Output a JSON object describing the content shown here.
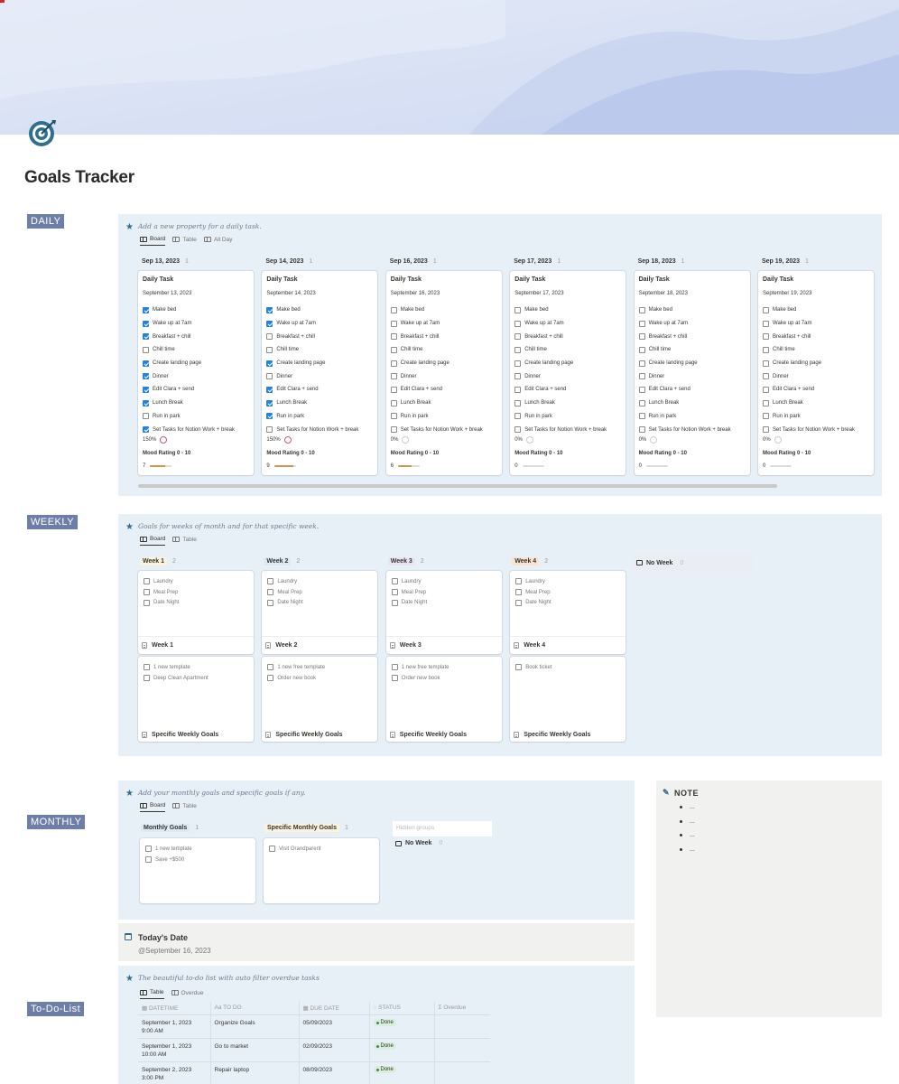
{
  "page": {
    "title": "Goals Tracker",
    "icon": "target-icon",
    "accent": "#2f6f8f",
    "section_label_color": "#6d7fa9"
  },
  "sections": {
    "daily": "DAILY",
    "weekly": "WEEKLY",
    "monthly": "MONTHLY",
    "todo": "To-Do-List"
  },
  "daily": {
    "description": "Add a new property for a daily task.",
    "views": [
      "Board",
      "Table",
      "All Day"
    ],
    "columns": [
      {
        "date": "Sep 13, 2023",
        "count": "1",
        "card_title": "Daily Task",
        "card_date": "September 13, 2023",
        "checked": [
          true,
          true,
          true,
          false,
          true,
          true,
          true,
          true,
          false,
          true
        ],
        "percent": "150%",
        "mood_label": "Mood Rating 0 - 10",
        "mood": "7",
        "mood_fraction": 0.7
      },
      {
        "date": "Sep 14, 2023",
        "count": "1",
        "card_title": "Daily Task",
        "card_date": "September 14, 2023",
        "checked": [
          true,
          true,
          false,
          false,
          true,
          false,
          true,
          true,
          true,
          false
        ],
        "percent": "150%",
        "mood_label": "Mood Rating 0 - 10",
        "mood": "9",
        "mood_fraction": 0.9
      },
      {
        "date": "Sep 16, 2023",
        "count": "1",
        "card_title": "Daily Task",
        "card_date": "September 16, 2023",
        "checked": [
          false,
          false,
          false,
          false,
          false,
          false,
          false,
          false,
          false,
          false
        ],
        "percent": "0%",
        "mood_label": "Mood Rating 0 - 10",
        "mood": "6",
        "mood_fraction": 0.6
      },
      {
        "date": "Sep 17, 2023",
        "count": "1",
        "card_title": "Daily Task",
        "card_date": "September 17, 2023",
        "checked": [
          false,
          false,
          false,
          false,
          false,
          false,
          false,
          false,
          false,
          false
        ],
        "percent": "0%",
        "mood_label": "Mood Rating 0 - 10",
        "mood": "0",
        "mood_fraction": 0
      },
      {
        "date": "Sep 18, 2023",
        "count": "1",
        "card_title": "Daily Task",
        "card_date": "September 18, 2023",
        "checked": [
          false,
          false,
          false,
          false,
          false,
          false,
          false,
          false,
          false,
          false
        ],
        "percent": "0%",
        "mood_label": "Mood Rating 0 - 10",
        "mood": "0",
        "mood_fraction": 0
      },
      {
        "date": "Sep 19, 2023",
        "count": "1",
        "card_title": "Daily Task",
        "card_date": "September 19, 2023",
        "checked": [
          false,
          false,
          false,
          false,
          false,
          false,
          false,
          false,
          false,
          false
        ],
        "percent": "0%",
        "mood_label": "Mood Rating 0 - 10",
        "mood": "0",
        "mood_fraction": 0
      }
    ],
    "tasks": [
      "Make bed",
      "Wake up at 7am",
      "Breakfast + chill",
      "Chill time",
      "Create landing page",
      "Dinner",
      "Edit Clara + send",
      "Lunch Break",
      "Run in park",
      "Set Tasks for Notion Work + break"
    ]
  },
  "weekly": {
    "description": "Goals for weeks of month and for that specific week.",
    "views": [
      "Board",
      "Table"
    ],
    "columns": [
      {
        "label": "Week 1",
        "count": "2",
        "color": "#fbf3db",
        "card1": {
          "items": [
            "Laundry",
            "Meal Prep",
            "Date Night"
          ],
          "title": "Week 1"
        },
        "card2": {
          "items": [
            "1 new template",
            "Deep Clean Apartment"
          ],
          "title": "Specific Weekly Goals"
        }
      },
      {
        "label": "Week 2",
        "count": "2",
        "color": "#dde9f4",
        "card1": {
          "items": [
            "Laundry",
            "Meal Prep",
            "Date Night"
          ],
          "title": "Week 2"
        },
        "card2": {
          "items": [
            "1 new free template",
            "Order new book"
          ],
          "title": "Specific Weekly Goals"
        }
      },
      {
        "label": "Week 3",
        "count": "2",
        "color": "#eae4f2",
        "card1": {
          "items": [
            "Laundry",
            "Meal Prep",
            "Date Night"
          ],
          "title": "Week 3"
        },
        "card2": {
          "items": [
            "1 new free template",
            "Order new book"
          ],
          "title": "Specific Weekly Goals"
        }
      },
      {
        "label": "Week 4",
        "count": "2",
        "color": "#fae3cf",
        "card1": {
          "items": [
            "Laundry",
            "Meal Prep",
            "Date Night"
          ],
          "title": "Week 4"
        },
        "card2": {
          "items": [
            "Book ticket"
          ],
          "title": "Specific Weekly Goals"
        }
      }
    ],
    "no_week": {
      "label": "No Week",
      "count": "0"
    }
  },
  "monthly": {
    "description": "Add your monthly goals and specific goals if any.",
    "views": [
      "Board",
      "Table"
    ],
    "columns": [
      {
        "label": "Monthly Goals",
        "count": "1",
        "color": "#dde9f4",
        "items": [
          "1 new template",
          "Save +$500"
        ]
      },
      {
        "label": "Specific Monthly Goals",
        "count": "1",
        "color": "#fbf3db",
        "items": [
          "Visit Grandparent"
        ]
      }
    ],
    "hidden_groups": "Hidden groups",
    "no_week": {
      "label": "No Week",
      "count": "0"
    }
  },
  "note": {
    "title": "NOTE",
    "items": [
      "...",
      "...",
      "...",
      "..."
    ]
  },
  "today": {
    "title": "Today's Date",
    "date": "@September 16, 2023"
  },
  "todo": {
    "description": "The beautiful to-do list with auto filter overdue tasks",
    "views": [
      "Table",
      "Overdue"
    ],
    "headers": [
      "DATETIME",
      "TO DO",
      "DUE DATE",
      "STATUS",
      "Overdue"
    ],
    "rows": [
      {
        "datetime": "September 1, 2023",
        "time": "9:00 AM",
        "todo": "Organize Goals",
        "due": "05/09/2023",
        "status": "Done"
      },
      {
        "datetime": "September 1, 2023",
        "time": "10:00 AM",
        "todo": "Go to market",
        "due": "02/09/2023",
        "status": "Done"
      },
      {
        "datetime": "September 2, 2023",
        "time": "3:00 PM",
        "todo": "Repair laptop",
        "due": "08/09/2023",
        "status": "Done"
      }
    ]
  }
}
